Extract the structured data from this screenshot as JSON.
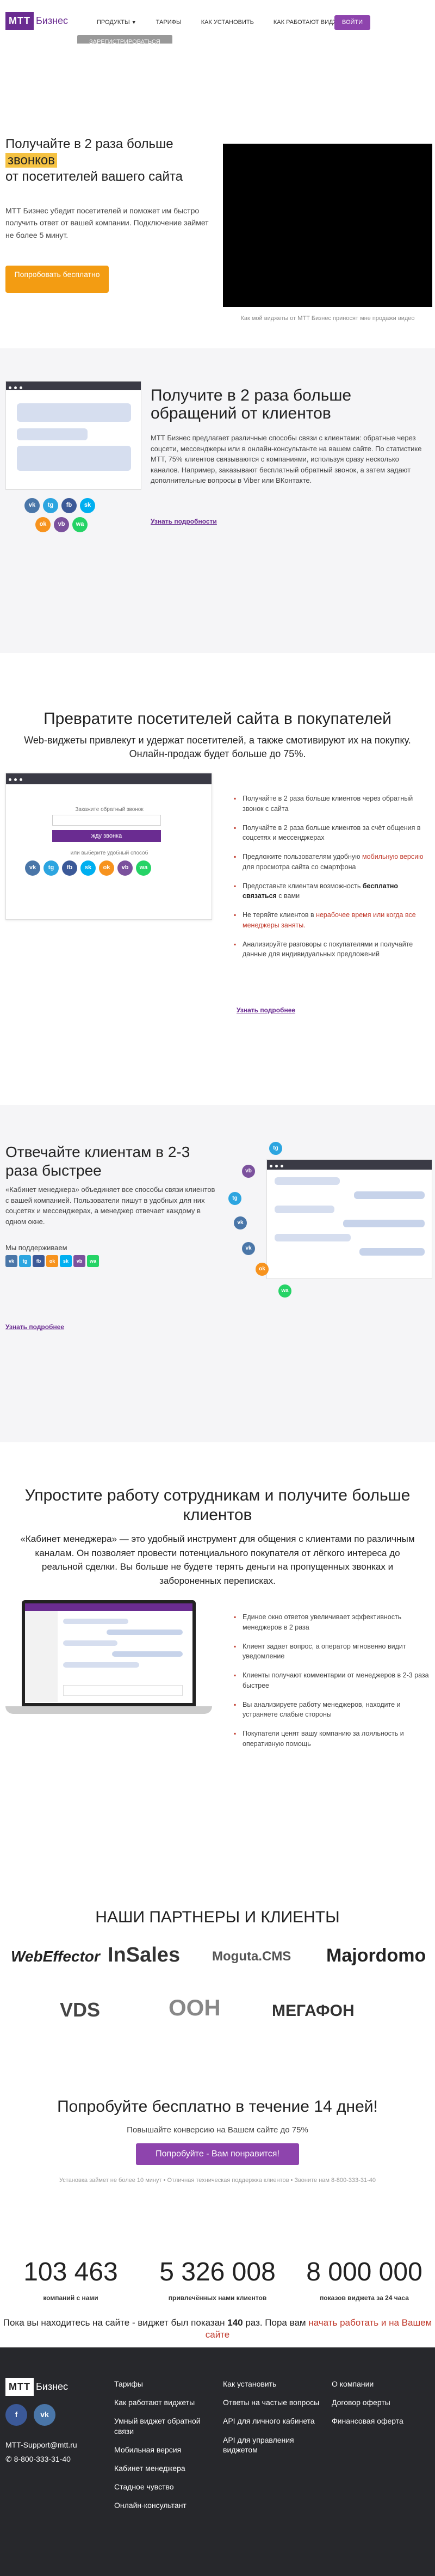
{
  "header": {
    "logo_box": "МТТ",
    "logo_text": "Бизнес",
    "nav": [
      {
        "label": "Продукты",
        "caret": "▼"
      },
      {
        "label": "Тарифы"
      },
      {
        "label": "Как установить"
      },
      {
        "label": "Как работают виджеты"
      }
    ],
    "login_label": "Войти",
    "register_label": "Зарегистрироваться"
  },
  "hero": {
    "title_line1": "Получайте в 2 раза больше",
    "title_highlight": "звонков",
    "title_line3": "от посетителей вашего сайта",
    "subtitle": "МТТ Бизнес убедит посетителей и поможет им быстро получить ответ от вашей компании. Подключение займет не более 5 минут.",
    "cta": "Попробовать бесплатно",
    "video_caption": "Как мой виджеты от МТТ Бизнес приносят мне продажи видео"
  },
  "sec2": {
    "title": "Получите в 2 раза больше обращений от клиентов",
    "text": "МТТ Бизнес предлагает различные способы связи с клиентами: обратные через соцсети, мессенджеры или в онлайн-консультанте на вашем сайте. По статистике МТТ, 75% клиентов связываются с компаниями, используя сразу несколько каналов. Например, заказывают бесплатный обратный звонок, а затем задают дополнительные вопросы в Viber или ВКонтакте.",
    "more": "Узнать подробности",
    "icons": [
      "vk",
      "tg",
      "fb",
      "sk",
      "ok",
      "vb",
      "wa"
    ]
  },
  "sec3": {
    "title": "Превратите посетителей сайта в покупателей",
    "subtitle": "Web-виджеты привлекут и удержат посетителей, а также смотивируют их на покупку. Онлайн-продаж будет больше до 75%.",
    "form_caption": "Закажите обратный звонок",
    "form_button": "жду звонка",
    "form_caption2": "или выберите удобный способ",
    "bullets": [
      {
        "text": "Получайте в 2 раза больше клиентов через обратный звонок с сайта"
      },
      {
        "text": "Получайте в 2 раза больше клиентов за счёт общения в соцсетях и мессенджерах"
      },
      {
        "pre": "Предложите пользователям удобную ",
        "red": "мобильную версию",
        "post": " для просмотра сайта со смартфона"
      },
      {
        "pre": "Предоставьте клиентам возможность ",
        "bold": "бесплатно связаться",
        "post": " с вами"
      },
      {
        "pre": "Не теряйте клиентов в ",
        "red": "нерабочее время или когда все менеджеры заняты."
      },
      {
        "text": "Анализируйте разговоры с покупателями и получайте данные для индивидуальных предложений"
      }
    ],
    "more": "Узнать подробнее"
  },
  "sec4": {
    "title": "Отвечайте клиентам в 2-3 раза быстрее",
    "text": "«Кабинет менеджера» объединяет все способы связи клиентов с вашей компанией. Пользователи пишут в удобных для них соцсетях и мессенджерах, а менеджер отвечает каждому в одном окне.",
    "support": "Мы поддерживаем",
    "icons": [
      "vk",
      "tg",
      "fb",
      "ok",
      "sk",
      "vb",
      "wa"
    ],
    "more": "Узнать подробнее"
  },
  "sec5": {
    "title": "Упростите работу сотрудникам и получите больше клиентов",
    "text": "«Кабинет менеджера» — это удобный инструмент для общения с клиентами по различным каналам. Он позволяет провести потенциального покупателя от лёгкого интереса до реальной сделки. Вы больше не будете терять деньги на пропущенных звонках и забороненных переписках.",
    "bullets": [
      "Единое окно ответов увеличивает эффективность менеджеров в 2 раза",
      "Клиент задает вопрос, а оператор мгновенно видит уведомление",
      "Клиенты получают комментарии от менеджеров в 2-3 раза быстрее",
      "Вы анализируете работу менеджеров, находите и устраняете слабые стороны",
      "Покупатели ценят вашу компанию за лояльность и оперативную помощь"
    ]
  },
  "partners": {
    "title": "НАШИ ПАРТНЕРЫ И КЛИЕНТЫ",
    "logos": [
      "WebEffector",
      "InSales",
      "Moguta.CMS",
      "Majordomo",
      "VDS",
      "ООН",
      "МЕГАФОН"
    ]
  },
  "trial": {
    "title": "Попробуйте бесплатно в течение 14 дней!",
    "subtitle": "Повышайте конверсию на Вашем сайте до 75%",
    "button": "Попробуйте - Вам понравится!",
    "note": "Установка займет не более 10 минут  •  Отличная техническая поддержка клиентов  •  Звоните нам 8-800-333-31-40"
  },
  "stats": [
    {
      "num": "103 463",
      "label": "компаний с нами"
    },
    {
      "num": "5 326 008",
      "label": "привлечённых нами клиентов"
    },
    {
      "num": "8 000 000",
      "label": "показов виджета за 24 часа"
    }
  ],
  "visitors": {
    "pre": "Пока вы находитесь на сайте - виджет был показан ",
    "count": "140",
    "mid": " раз. Пора вам ",
    "link": "начать работать и на Вашем сайте"
  },
  "footer": {
    "logo_box": "МТТ",
    "logo_text": "Бизнес",
    "email": "MTT-Support@mtt.ru",
    "phone": "8-800-333-31-40",
    "col1": [
      "Тарифы",
      "Как работают виджеты",
      "Умный виджет обратной связи",
      "Мобильная версия",
      "Кабинет менеджера",
      "Стадное чувство",
      "Онлайн-консультант"
    ],
    "col2": [
      "Как установить",
      "Ответы на частые вопросы",
      "API для личного кабинета",
      "API для управления виджетом"
    ],
    "col3": [
      "О компании",
      "Договор оферты",
      "Финансовая оферта"
    ]
  }
}
